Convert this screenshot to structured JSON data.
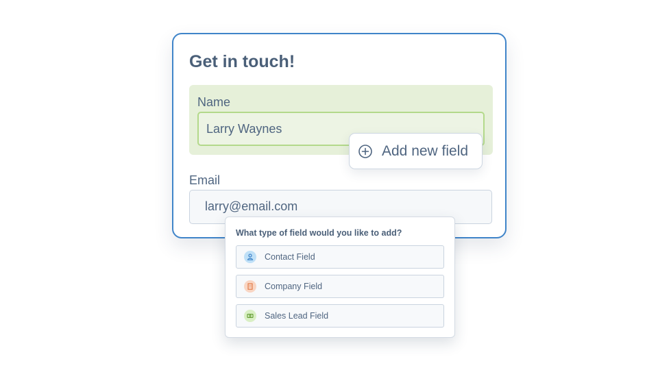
{
  "form": {
    "title": "Get in touch!",
    "name_label": "Name",
    "name_value": "Larry Waynes",
    "email_label": "Email",
    "email_value": "larry@email.com"
  },
  "add_field_button": {
    "label": "Add new field",
    "icon": "plus-circle-icon"
  },
  "field_menu": {
    "question": "What type of field would you like to add?",
    "options": [
      {
        "label": "Contact Field",
        "icon": "person-icon",
        "color": "#bfe0f7",
        "icon_color": "#3f84c9"
      },
      {
        "label": "Company Field",
        "icon": "building-icon",
        "color": "#f9d6c4",
        "icon_color": "#e0733f"
      },
      {
        "label": "Sales Lead Field",
        "icon": "money-icon",
        "color": "#d9efc4",
        "icon_color": "#5f9a2e"
      }
    ]
  },
  "colors": {
    "accent_border": "#3f84c9",
    "name_section_bg": "#e6f0d9",
    "name_input_border": "#b3d98a",
    "text": "#4f6580"
  }
}
